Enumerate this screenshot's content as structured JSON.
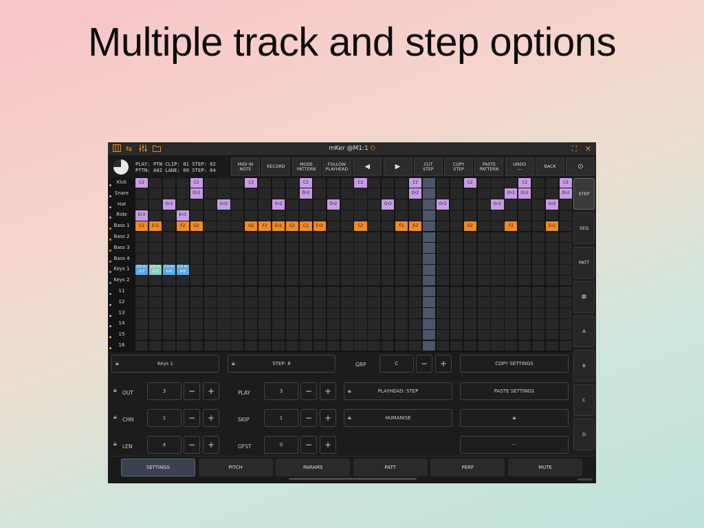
{
  "headline": "Multiple track and step options",
  "window": {
    "title": "mKer @M1:1"
  },
  "status": {
    "line1": "PLAY: PTN CLIP: 01 STEP: 02",
    "line2": "PTTN: A02 LANE: 09 STEP: 04"
  },
  "transport_buttons": [
    {
      "l1": "MIDI IN",
      "l2": "NOTE"
    },
    {
      "l1": "RECORD",
      "l2": ""
    },
    {
      "l1": "MODE",
      "l2": "PATTERN"
    },
    {
      "l1": "FOLLOW",
      "l2": "PLAYHEAD"
    },
    {
      "l1": "◀",
      "l2": ""
    },
    {
      "l1": "▶",
      "l2": ""
    },
    {
      "l1": "CUT",
      "l2": "STEP"
    },
    {
      "l1": "COPY",
      "l2": "STEP"
    },
    {
      "l1": "PASTE",
      "l2": "PATTERN"
    },
    {
      "l1": "UNDO",
      "l2": "---"
    },
    {
      "l1": "BACK",
      "l2": ""
    },
    {
      "l1": "⊙",
      "l2": ""
    }
  ],
  "tracks": [
    "Kick",
    "Snare",
    "Hat",
    "Ride",
    "Bass 1",
    "Bass 2",
    "Bass 3",
    "Bass 4",
    "Keys 1",
    "Keys 2",
    "11",
    "12",
    "13",
    "14",
    "15",
    "16"
  ],
  "track_dot_colors": [
    "#c89be6",
    "#c89be6",
    "#c89be6",
    "#c89be6",
    "#f08a24",
    "#f08a24",
    "#f08a24",
    "#f08a24",
    "#5aa9e6",
    "#5aa9e6",
    "#5aa9e6",
    "#c89be6",
    "#c89be6",
    "#c89be6",
    "#f0b030",
    "#f0b030"
  ],
  "steps": 32,
  "playhead_step": 21,
  "colors": {
    "purple": "#c89be6",
    "orange": "#f08a24",
    "blue": "#5aa9e6",
    "accent": "#f08a24"
  },
  "notes": [
    {
      "t": 0,
      "s": 0,
      "n": "C2",
      "c": "purple"
    },
    {
      "t": 0,
      "s": 4,
      "n": "C2",
      "c": "purple"
    },
    {
      "t": 0,
      "s": 8,
      "n": "C2",
      "c": "purple"
    },
    {
      "t": 0,
      "s": 12,
      "n": "C2",
      "c": "purple"
    },
    {
      "t": 0,
      "s": 16,
      "n": "C2",
      "c": "purple"
    },
    {
      "t": 0,
      "s": 20,
      "n": "C2",
      "c": "purple"
    },
    {
      "t": 0,
      "s": 24,
      "n": "C2",
      "c": "purple"
    },
    {
      "t": 0,
      "s": 28,
      "n": "C2",
      "c": "purple"
    },
    {
      "t": 0,
      "s": 31,
      "n": "C2",
      "c": "purple"
    },
    {
      "t": 1,
      "s": 4,
      "n": "D♯2",
      "c": "purple"
    },
    {
      "t": 1,
      "s": 12,
      "n": "D♯2",
      "c": "purple"
    },
    {
      "t": 1,
      "s": 20,
      "n": "D♯2",
      "c": "purple"
    },
    {
      "t": 1,
      "s": 27,
      "n": "D♯2",
      "c": "purple"
    },
    {
      "t": 1,
      "s": 28,
      "n": "D♯2",
      "c": "purple"
    },
    {
      "t": 1,
      "s": 31,
      "n": "D♯2",
      "c": "purple"
    },
    {
      "t": 2,
      "s": 2,
      "n": "G♯2",
      "c": "purple"
    },
    {
      "t": 2,
      "s": 6,
      "n": "G♯2",
      "c": "purple"
    },
    {
      "t": 2,
      "s": 10,
      "n": "G♯2",
      "c": "purple"
    },
    {
      "t": 2,
      "s": 14,
      "n": "G♯2",
      "c": "purple"
    },
    {
      "t": 2,
      "s": 18,
      "n": "G♯2",
      "c": "purple"
    },
    {
      "t": 2,
      "s": 22,
      "n": "G♯2",
      "c": "purple"
    },
    {
      "t": 2,
      "s": 26,
      "n": "G♯2",
      "c": "purple"
    },
    {
      "t": 2,
      "s": 30,
      "n": "G♯2",
      "c": "purple"
    },
    {
      "t": 3,
      "s": 0,
      "n": "E♯3",
      "c": "purple"
    },
    {
      "t": 3,
      "s": 3,
      "n": "E♯3",
      "c": "purple"
    },
    {
      "t": 4,
      "s": 0,
      "n": "C2",
      "c": "orange"
    },
    {
      "t": 4,
      "s": 1,
      "n": "E♯2",
      "c": "orange"
    },
    {
      "t": 4,
      "s": 3,
      "n": "F2",
      "c": "orange"
    },
    {
      "t": 4,
      "s": 4,
      "n": "G2",
      "c": "orange"
    },
    {
      "t": 4,
      "s": 8,
      "n": "G2",
      "c": "orange"
    },
    {
      "t": 4,
      "s": 9,
      "n": "F2",
      "c": "orange"
    },
    {
      "t": 4,
      "s": 10,
      "n": "E♯2",
      "c": "orange"
    },
    {
      "t": 4,
      "s": 11,
      "n": "C2",
      "c": "orange"
    },
    {
      "t": 4,
      "s": 12,
      "n": "C2",
      "c": "orange"
    },
    {
      "t": 4,
      "s": 13,
      "n": "E♯2",
      "c": "orange"
    },
    {
      "t": 4,
      "s": 16,
      "n": "C2",
      "c": "orange"
    },
    {
      "t": 4,
      "s": 19,
      "n": "F2",
      "c": "orange"
    },
    {
      "t": 4,
      "s": 20,
      "n": "G2",
      "c": "orange"
    },
    {
      "t": 4,
      "s": 24,
      "n": "G2",
      "c": "orange"
    },
    {
      "t": 4,
      "s": 27,
      "n": "F2",
      "c": "orange"
    },
    {
      "t": 4,
      "s": 30,
      "n": "E♯2",
      "c": "orange"
    },
    {
      "t": 8,
      "s": 0,
      "n": "C2 m",
      "n2": "in7",
      "c": "blue"
    },
    {
      "t": 8,
      "s": 1,
      "n": "C2 m",
      "n2": "in7",
      "c": "blue"
    },
    {
      "t": 8,
      "s": 2,
      "n": "C2 m",
      "n2": "in9",
      "c": "blue"
    },
    {
      "t": 8,
      "s": 3,
      "n": "C2 m",
      "n2": "in9",
      "c": "blue"
    }
  ],
  "side_nav": [
    "STEP",
    "SEQ",
    "PATT",
    "✲",
    "A",
    "B",
    "C",
    "D"
  ],
  "panel": {
    "track_name": "Keys 1",
    "step_label": "STEP: 8",
    "grp_label": "GRP",
    "grp_value": "C",
    "copy_settings": "COPY SETTINGS",
    "paste_settings": "PASTE SETTINGS",
    "out_label": "OUT",
    "out_value": "3",
    "chn_label": "CHN",
    "chn_value": "1",
    "len_label": "LEN",
    "len_value": "4",
    "play_label": "PLAY",
    "play_value": "3",
    "skip_label": "SKIP",
    "skip_value": "1",
    "ofst_label": "OFST",
    "ofst_value": "0",
    "playhead_mode": "PLAYHEAD: STEP",
    "humanise": "HUMANISE",
    "more": "···",
    "minus": "−",
    "plus": "+"
  },
  "bottom_tabs": [
    "SETTINGS",
    "PITCH",
    "PARAMS",
    "PATT",
    "PERF",
    "MUTE"
  ]
}
